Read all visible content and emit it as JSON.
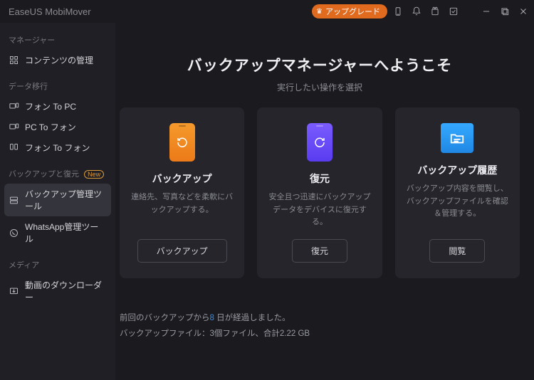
{
  "app_title": "EaseUS MobiMover",
  "upgrade_label": "アップグレード",
  "sidebar": {
    "sections": [
      {
        "label": "マネージャー",
        "items": [
          {
            "icon": "grid",
            "label": "コンテンツの管理"
          }
        ]
      },
      {
        "label": "データ移行",
        "items": [
          {
            "icon": "phone-to-pc",
            "label": "フォン To PC"
          },
          {
            "icon": "pc-to-phone",
            "label": "PC To フォン"
          },
          {
            "icon": "phone-to-phone",
            "label": "フォン To フォン"
          }
        ]
      },
      {
        "label": "バックアップと復元",
        "badge": "New",
        "items": [
          {
            "icon": "backup-tool",
            "label": "バックアップ管理ツール",
            "active": true
          },
          {
            "icon": "whatsapp",
            "label": "WhatsApp管理ツール"
          }
        ]
      },
      {
        "label": "メディア",
        "items": [
          {
            "icon": "download",
            "label": "動画のダウンローダー"
          }
        ]
      }
    ]
  },
  "hero": {
    "title": "バックアップマネージャーへようこそ",
    "subtitle": "実行したい操作を選択"
  },
  "cards": [
    {
      "title": "バックアップ",
      "desc": "連絡先、写真などを柔軟にバックアップする。",
      "button": "バックアップ"
    },
    {
      "title": "復元",
      "desc": "安全且つ迅速にバックアップデータをデバイスに復元する。",
      "button": "復元"
    },
    {
      "title": "バックアップ履歴",
      "desc": "バックアップ内容を閲覧し、バックアップファイルを確認＆管理する。",
      "button": "閲覧"
    }
  ],
  "footer": {
    "line1_pre": "前回のバックアップから",
    "line1_days": "8",
    "line1_post": " 日が経過しました。",
    "line2": "バックアップファイル：3個ファイル、合計2.22 GB"
  }
}
